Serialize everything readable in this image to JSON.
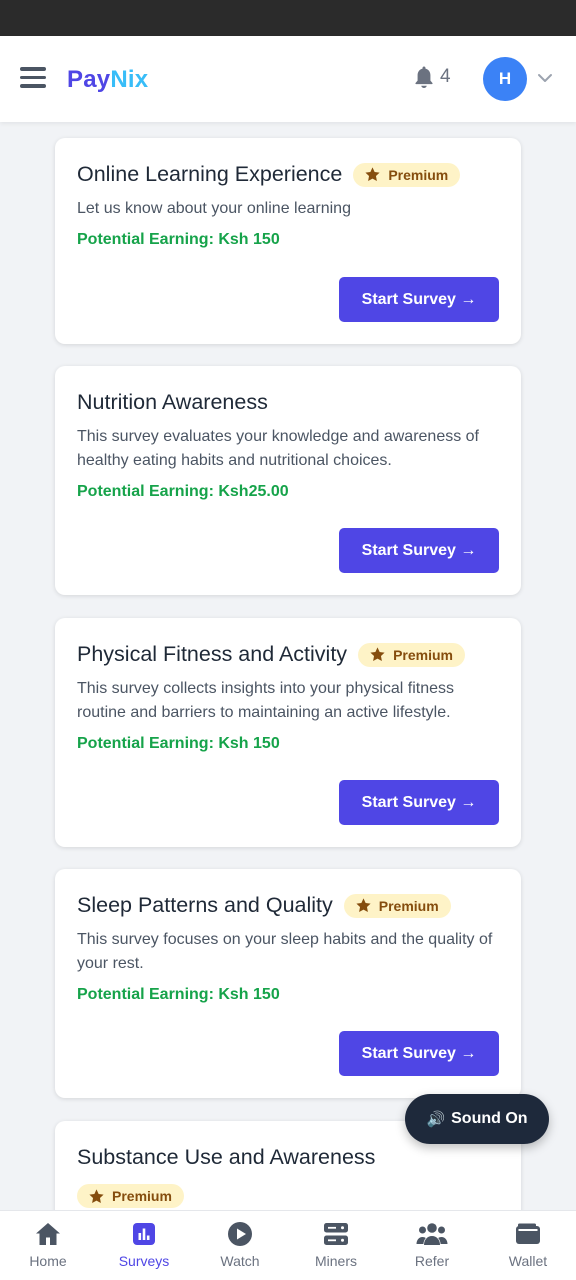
{
  "app": {
    "logo_part1": "Pay",
    "logo_part2": "Nix"
  },
  "header": {
    "notification_count": "4",
    "avatar_initial": "H"
  },
  "surveys": [
    {
      "title": "Online Learning Experience",
      "premium": true,
      "badge": "Premium",
      "description": "Let us know about your online learning",
      "earning": "Potential Earning: Ksh 150",
      "button": "Start Survey →"
    },
    {
      "title": "Nutrition Awareness",
      "premium": false,
      "badge": "",
      "description": "This survey evaluates your knowledge and awareness of healthy eating habits and nutritional choices.",
      "earning": "Potential Earning: Ksh25.00",
      "button": "Start Survey →"
    },
    {
      "title": "Physical Fitness and Activity",
      "premium": true,
      "badge": "Premium",
      "description": "This survey collects insights into your physical fitness routine and barriers to maintaining an active lifestyle.",
      "earning": "Potential Earning: Ksh 150",
      "button": "Start Survey →"
    },
    {
      "title": "Sleep Patterns and Quality",
      "premium": true,
      "badge": "Premium",
      "description": "This survey focuses on your sleep habits and the quality of your rest.",
      "earning": "Potential Earning: Ksh 150",
      "button": "Start Survey →"
    },
    {
      "title": "Substance Use and Awareness",
      "premium": true,
      "badge": "Premium"
    }
  ],
  "sound_button": {
    "icon": "🔊",
    "label": "Sound On"
  },
  "bottom_nav": [
    {
      "label": "Home",
      "icon": "home-icon",
      "active": false
    },
    {
      "label": "Surveys",
      "icon": "chart-icon",
      "active": true
    },
    {
      "label": "Watch",
      "icon": "play-icon",
      "active": false
    },
    {
      "label": "Miners",
      "icon": "server-icon",
      "active": false
    },
    {
      "label": "Refer",
      "icon": "users-icon",
      "active": false
    },
    {
      "label": "Wallet",
      "icon": "wallet-icon",
      "active": false
    }
  ],
  "colors": {
    "primary": "#4f46e5",
    "earning": "#16a34a",
    "premium_bg": "#fef3c7",
    "premium_text": "#854d0e"
  }
}
